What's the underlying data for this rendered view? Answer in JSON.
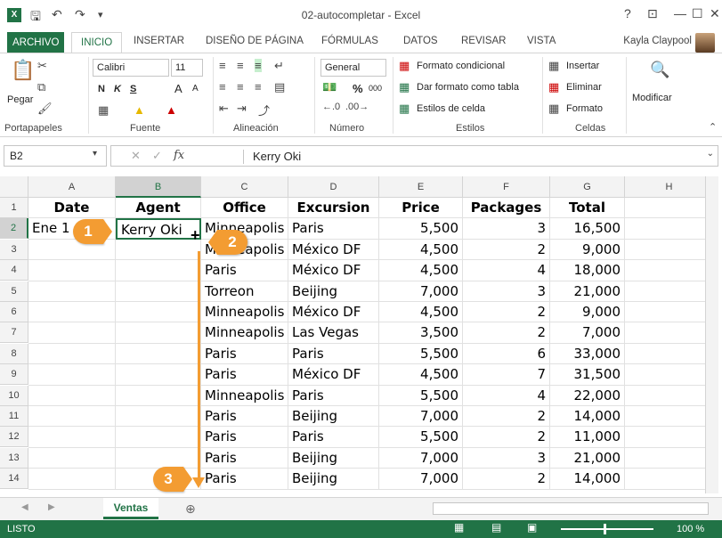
{
  "window": {
    "title": "02-autocompletar - Excel",
    "app_icon": "X",
    "help": "?",
    "ribbon_display": "⊡",
    "minimize": "—",
    "maximize": "☐",
    "close": "✕"
  },
  "ribbon_tabs": [
    "ARCHIVO",
    "INICIO",
    "INSERTAR",
    "DISEÑO DE PÁGINA",
    "FÓRMULAS",
    "DATOS",
    "REVISAR",
    "VISTA"
  ],
  "user": "Kayla Claypool",
  "ribbon": {
    "clipboard": {
      "paste": "Pegar",
      "label": "Portapapeles"
    },
    "font": {
      "family": "Calibri",
      "size": "11",
      "bold": "N",
      "italic": "K",
      "underline": "S",
      "grow": "A",
      "shrink": "A",
      "label": "Fuente"
    },
    "alignment": {
      "label": "Alineación"
    },
    "number": {
      "format": "General",
      "percent": "%",
      "thousands": "000",
      "label": "Número"
    },
    "styles": {
      "conditional": "Formato condicional",
      "as_table": "Dar formato como tabla",
      "cell_styles": "Estilos de celda",
      "label": "Estilos"
    },
    "cells": {
      "insert": "Insertar",
      "delete": "Eliminar",
      "format": "Formato",
      "label": "Celdas"
    },
    "editing": {
      "modify": "Modificar"
    }
  },
  "formula_bar": {
    "name_box": "B2",
    "fx": "fx",
    "content": "Kerry Oki"
  },
  "columns": [
    "A",
    "B",
    "C",
    "D",
    "E",
    "F",
    "G",
    "H"
  ],
  "rows": [
    [
      "Date",
      "Agent",
      "Office",
      "Excursion",
      "Price",
      "Packages",
      "Total",
      ""
    ],
    [
      "Ene 1",
      "Kerry Oki",
      "Minneapolis",
      "Paris",
      "5,500",
      "3",
      "16,500",
      ""
    ],
    [
      "",
      "",
      "Minneapolis",
      "México DF",
      "4,500",
      "2",
      "9,000",
      ""
    ],
    [
      "",
      "",
      "Paris",
      "México DF",
      "4,500",
      "4",
      "18,000",
      ""
    ],
    [
      "",
      "",
      "Torreon",
      "Beijing",
      "7,000",
      "3",
      "21,000",
      ""
    ],
    [
      "",
      "",
      "Minneapolis",
      "México DF",
      "4,500",
      "2",
      "9,000",
      ""
    ],
    [
      "",
      "",
      "Minneapolis",
      "Las Vegas",
      "3,500",
      "2",
      "7,000",
      ""
    ],
    [
      "",
      "",
      "Paris",
      "Paris",
      "5,500",
      "6",
      "33,000",
      ""
    ],
    [
      "",
      "",
      "Paris",
      "México DF",
      "4,500",
      "7",
      "31,500",
      ""
    ],
    [
      "",
      "",
      "Minneapolis",
      "Paris",
      "5,500",
      "4",
      "22,000",
      ""
    ],
    [
      "",
      "",
      "Paris",
      "Beijing",
      "7,000",
      "2",
      "14,000",
      ""
    ],
    [
      "",
      "",
      "Paris",
      "Paris",
      "5,500",
      "2",
      "11,000",
      ""
    ],
    [
      "",
      "",
      "Paris",
      "Beijing",
      "7,000",
      "3",
      "21,000",
      ""
    ],
    [
      "",
      "",
      "Paris",
      "Beijing",
      "7,000",
      "2",
      "14,000",
      ""
    ]
  ],
  "callouts": [
    "1",
    "2",
    "3"
  ],
  "sheet_tabs": [
    "Ventas"
  ],
  "status": {
    "mode": "LISTO",
    "zoom": "100 %"
  }
}
